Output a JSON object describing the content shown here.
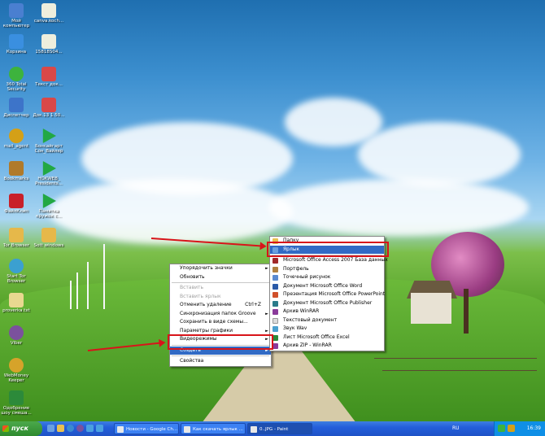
{
  "desktop_icons": [
    {
      "label": "Мой компьютер",
      "color": "#4a7fd0"
    },
    {
      "label": "Корзина",
      "color": "#3a8fe0"
    },
    {
      "label": "360 Total Security",
      "color": "#3db33d"
    },
    {
      "label": "Диспетчер",
      "color": "#3d74c9"
    },
    {
      "label": "mail_agent",
      "color": "#d4a017"
    },
    {
      "label": "Bookmarks",
      "color": "#b07a2a"
    },
    {
      "label": "ФайлКлип",
      "color": "#c8202a"
    },
    {
      "label": "Tor Browser",
      "color": "#e6b84a"
    },
    {
      "label": "Start Tor Browser",
      "color": "#3ba0d0"
    },
    {
      "label": "proverka.txt",
      "color": "#e8d890"
    },
    {
      "label": "Viber",
      "color": "#7b519d"
    },
    {
      "label": "WebMoney Keeper WinPro",
      "color": "#d6a32a"
    },
    {
      "label": "Одобрение шоу смеша...",
      "color": "#2c8a3a"
    }
  ],
  "desktop_icons2": [
    {
      "label": "canva.koch...",
      "color": "#eeeedd"
    },
    {
      "label": "15818S04...",
      "color": "#eeeedd"
    },
    {
      "label": "Текст док...",
      "color": "#d94848"
    },
    {
      "label": "Док.13 1.50...",
      "color": "#d94848"
    },
    {
      "label": "Бонсайгарт Сон_Вайлер",
      "color": "#22a844"
    },
    {
      "label": "HOKWEB_ Presidents...",
      "color": "#22a844"
    },
    {
      "label": "Памятка кружок с...",
      "color": "#22a844"
    },
    {
      "label": "Sott windows",
      "color": "#e6b84a"
    }
  ],
  "context_menu": {
    "items": [
      {
        "label": "Упорядочить значки",
        "arrow": "►",
        "disabled": false
      },
      {
        "label": "Обновить",
        "arrow": "",
        "disabled": false
      },
      {
        "label": "Вставить",
        "arrow": "",
        "disabled": true
      },
      {
        "label": "Вставить ярлык",
        "arrow": "",
        "disabled": true
      },
      {
        "label": "Отменить удаление",
        "shortcut": "Ctrl+Z",
        "disabled": false
      },
      {
        "label": "Синхронизация папок Groove",
        "arrow": "►",
        "disabled": false
      },
      {
        "label": "Сохранить в виде схемы...",
        "arrow": "",
        "disabled": false
      },
      {
        "label": "Параметры графики",
        "arrow": "►",
        "disabled": false
      },
      {
        "label": "Видеорежимы",
        "arrow": "►",
        "disabled": false
      },
      {
        "label": "Создать",
        "arrow": "►",
        "disabled": false
      },
      {
        "label": "Свойства",
        "arrow": "",
        "disabled": false
      }
    ]
  },
  "create_submenu": {
    "items": [
      {
        "label": "Папку",
        "color": "#e8c050"
      },
      {
        "label": "Ярлык",
        "color": "#6aa0e0"
      },
      {
        "label": "Microsoft Office Access 2007 База данных",
        "color": "#a0282a"
      },
      {
        "label": "Портфель",
        "color": "#b08040"
      },
      {
        "label": "Точечный рисунок",
        "color": "#5a8ad0"
      },
      {
        "label": "Документ Microsoft Office Word",
        "color": "#2a5aa8"
      },
      {
        "label": "Презентация Microsoft Office PowerPoint",
        "color": "#d0502a"
      },
      {
        "label": "Документ Microsoft Office Publisher",
        "color": "#2a7a8a"
      },
      {
        "label": "Архив WinRAR",
        "color": "#8a3a9a"
      },
      {
        "label": "Текстовый документ",
        "color": "#dcdcdc"
      },
      {
        "label": "Звук Wav",
        "color": "#4aa0d0"
      },
      {
        "label": "Лист Microsoft Office Excel",
        "color": "#2a8a3a"
      },
      {
        "label": "Архив ZIP - WinRAR",
        "color": "#8a3a9a"
      }
    ]
  },
  "taskbar": {
    "start_label": "пуск",
    "tasks": [
      "Новости - Google Ch...",
      "Как скачать ярлык ...",
      "0..JPG - Paint"
    ],
    "language": "RU",
    "clock": "16:39"
  }
}
